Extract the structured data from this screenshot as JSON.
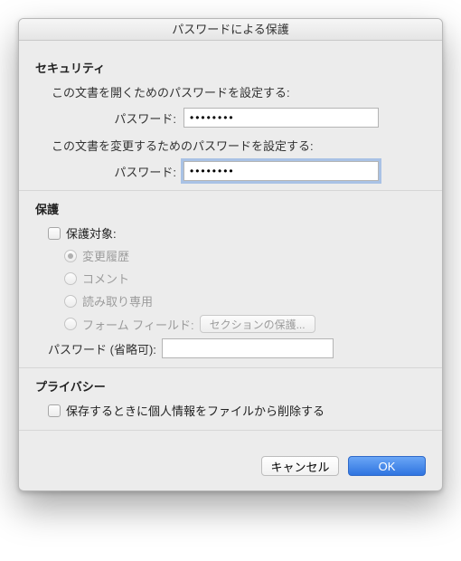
{
  "window": {
    "title": "パスワードによる保護"
  },
  "security": {
    "heading": "セキュリティ",
    "open_desc": "この文書を開くためのパスワードを設定する:",
    "open_label": "パスワード:",
    "open_value": "••••••••",
    "modify_desc": "この文書を変更するためのパスワードを設定する:",
    "modify_label": "パスワード:",
    "modify_value": "••••••••"
  },
  "protection": {
    "heading": "保護",
    "target_label": "保護対象:",
    "options": {
      "revisions": "変更履歴",
      "comments": "コメント",
      "readonly": "読み取り専用",
      "formfields": "フォーム フィールド:"
    },
    "sections_button": "セクションの保護...",
    "optional_pw_label": "パスワード (省略可):",
    "optional_pw_value": ""
  },
  "privacy": {
    "heading": "プライバシー",
    "remove_personal": "保存するときに個人情報をファイルから削除する"
  },
  "buttons": {
    "cancel": "キャンセル",
    "ok": "OK"
  }
}
